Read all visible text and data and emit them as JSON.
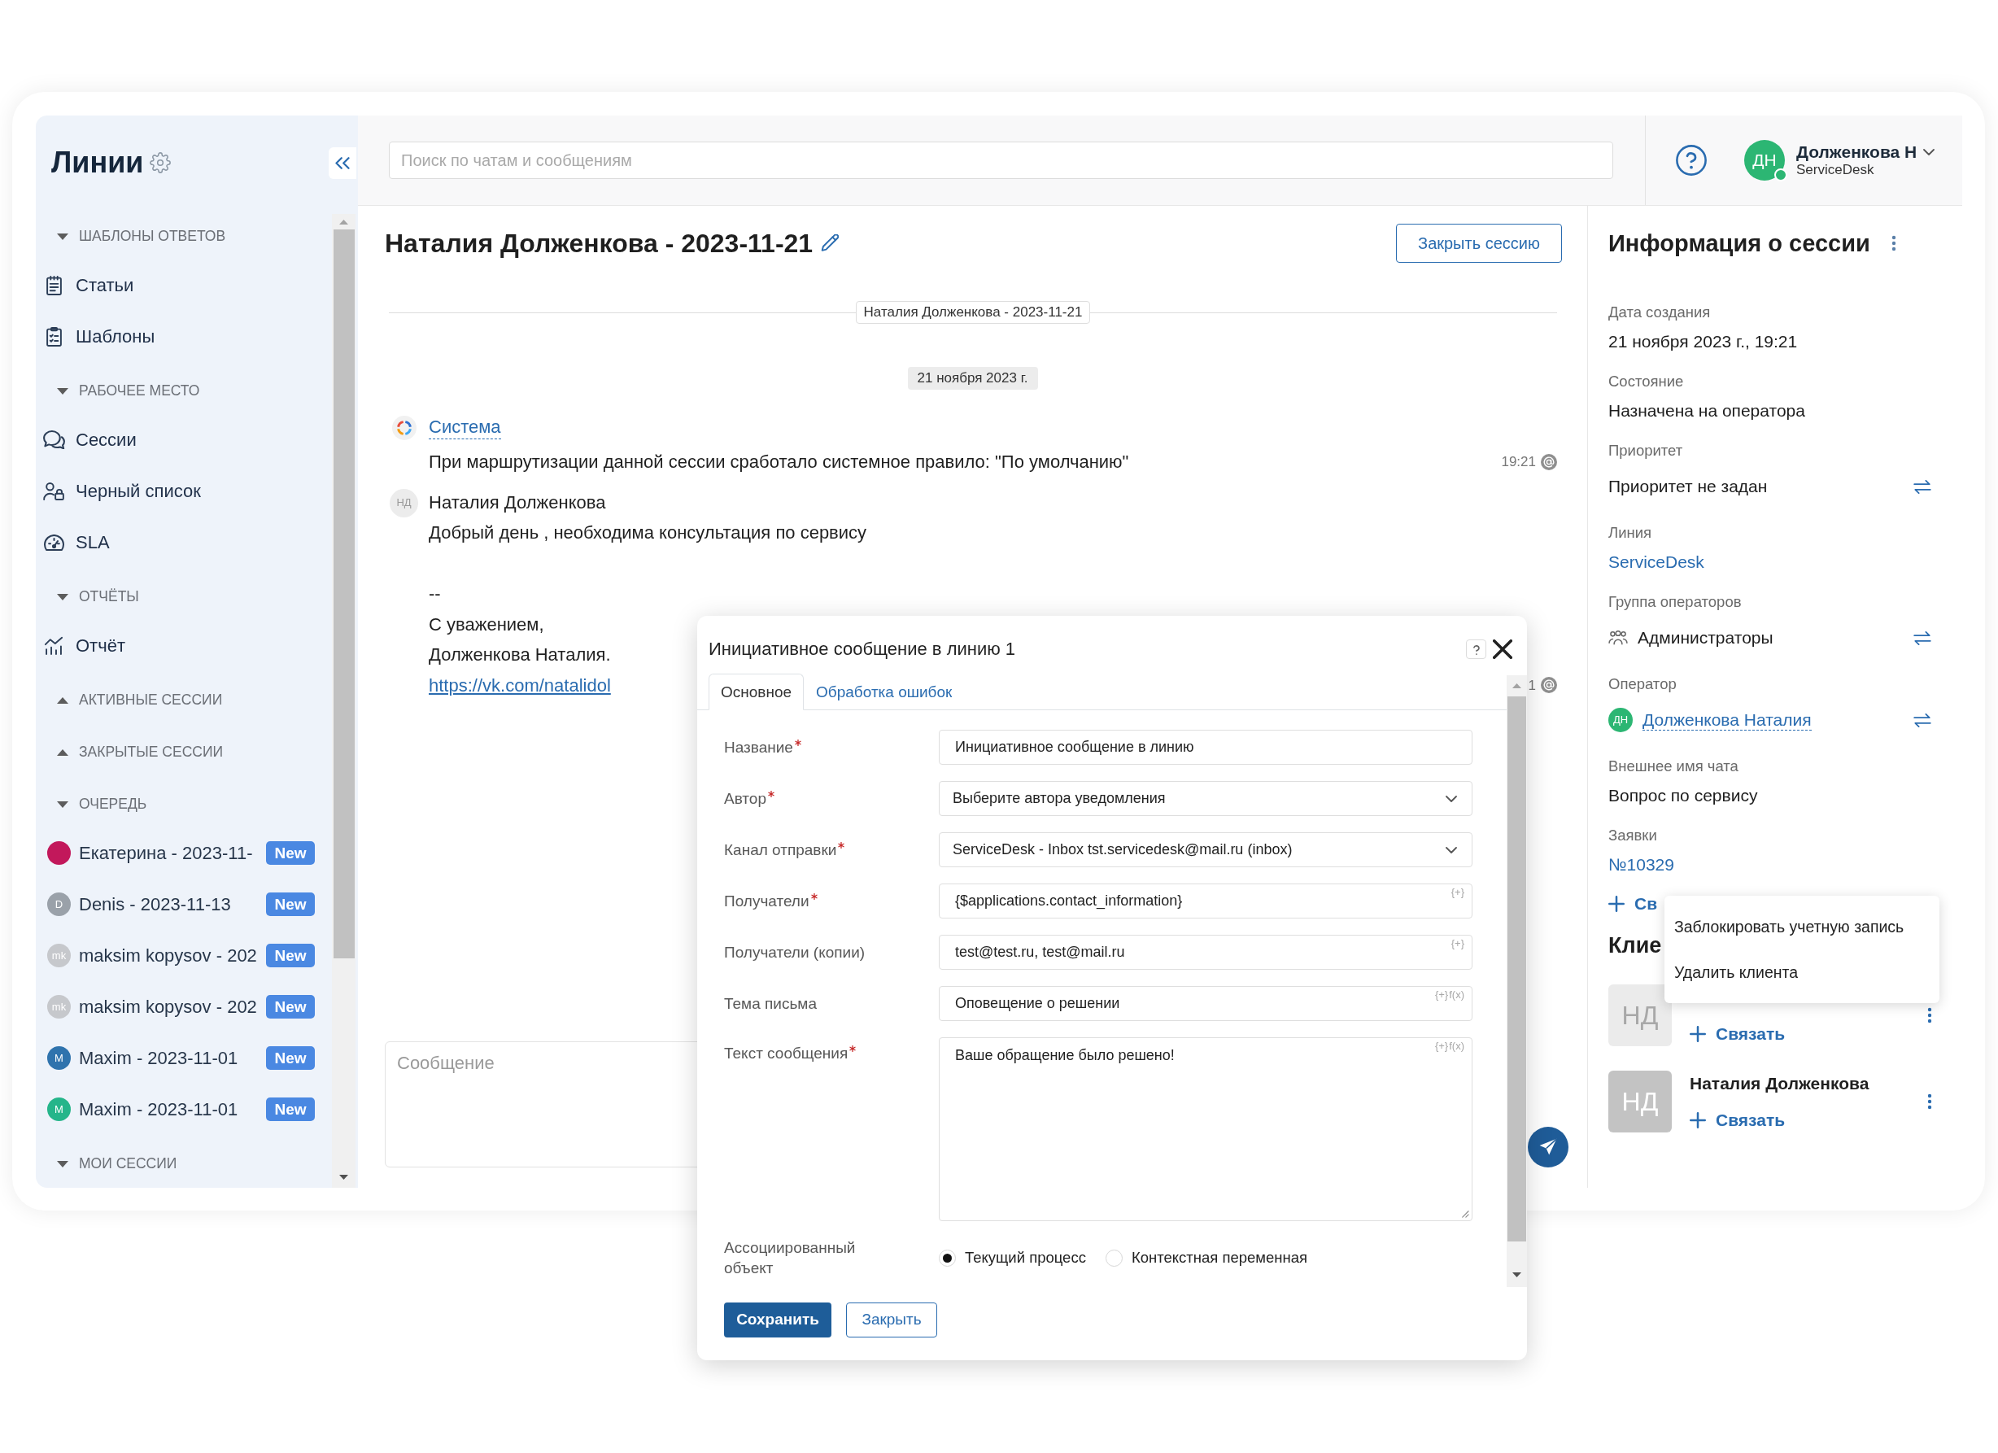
{
  "sidebar": {
    "title": "Линии",
    "sections": [
      {
        "label": "ШАБЛОНЫ ОТВЕТОВ",
        "expanded": true,
        "items": [
          {
            "kind": "page",
            "label": "Статьи"
          },
          {
            "kind": "page",
            "label": "Шаблоны"
          }
        ]
      },
      {
        "label": "РАБОЧЕЕ МЕСТО",
        "expanded": true,
        "items": [
          {
            "kind": "page",
            "label": "Сессии"
          },
          {
            "kind": "page",
            "label": "Черный список"
          },
          {
            "kind": "page",
            "label": "SLA"
          }
        ]
      },
      {
        "label": "ОТЧЁТЫ",
        "expanded": true,
        "items": [
          {
            "kind": "page",
            "label": "Отчёт"
          }
        ]
      },
      {
        "label": "АКТИВНЫЕ СЕССИИ",
        "expanded": false
      },
      {
        "label": "ЗАКРЫТЫЕ СЕССИИ",
        "expanded": false
      },
      {
        "label": "ОЧЕРЕДЬ",
        "expanded": true,
        "items": [
          {
            "kind": "session",
            "label": "Екатерина - 2023-11-",
            "avatar": {
              "kind": "photo",
              "color": "#c2185b"
            },
            "badge": "New"
          },
          {
            "kind": "session",
            "label": "Denis - 2023-11-13",
            "avatar": {
              "kind": "initials",
              "text": "D",
              "color": "#9aa1a9"
            },
            "badge": "New"
          },
          {
            "kind": "session",
            "label": "maksim kopysov - 202",
            "avatar": {
              "kind": "initials",
              "text": "mk",
              "color": "#c6c8cc"
            },
            "badge": "New"
          },
          {
            "kind": "session",
            "label": "maksim kopysov - 202",
            "avatar": {
              "kind": "initials",
              "text": "mk",
              "color": "#c6c8cc"
            },
            "badge": "New"
          },
          {
            "kind": "session",
            "label": "Maxim - 2023-11-01",
            "avatar": {
              "kind": "initials",
              "text": "M",
              "color": "#2f73ad"
            },
            "badge": "New"
          },
          {
            "kind": "session",
            "label": "Maxim - 2023-11-01",
            "avatar": {
              "kind": "initials",
              "text": "M",
              "color": "#25b58a"
            },
            "badge": "New"
          }
        ]
      },
      {
        "label": "МОИ СЕССИИ",
        "expanded": true
      }
    ]
  },
  "header": {
    "search": {
      "placeholder": "Поиск по чатам и сообщениям"
    },
    "user": {
      "initials": "ДН",
      "name": "Долженкова Н",
      "subtitle": "ServiceDesk",
      "online": true
    }
  },
  "chat": {
    "title": "Наталия Долженкова - 2023-11-21",
    "close_button": "Закрыть сессию",
    "session_divider": "Наталия Долженкова - 2023-11-21",
    "date": "21 ноября 2023 г.",
    "messages": [
      {
        "kind": "system",
        "author": "Система",
        "text": "При маршрутизации данной сессии сработало системное правило: \"По умолчанию\"",
        "time": "19:21"
      },
      {
        "kind": "client",
        "avatar": "НД",
        "author": "Наталия Долженкова",
        "text": "Добрый день , необходима консультация по сервису",
        "signature": [
          "--",
          "С уважением,",
          "Долженкова Наталия."
        ],
        "link": "https://vk.com/natalidol",
        "time": "1"
      }
    ],
    "composer": {
      "placeholder": "Сообщение"
    }
  },
  "session_info": {
    "title": "Информация о сессии",
    "fields": [
      {
        "kind": "text",
        "label": "Дата создания",
        "value": "21 ноября 2023 г., 19:21",
        "swap": false
      },
      {
        "kind": "text",
        "label": "Состояние",
        "value": "Назначена на оператора",
        "swap": false
      },
      {
        "kind": "text",
        "label": "Приоритет",
        "value": "Приоритет не задан",
        "swap": true
      },
      {
        "kind": "link",
        "label": "Линия",
        "value": "ServiceDesk",
        "swap": false
      },
      {
        "kind": "group",
        "label": "Группа операторов",
        "value": "Администраторы",
        "swap": true
      },
      {
        "kind": "user",
        "label": "Оператор",
        "avatar": "ДН",
        "value": "Долженкова Наталия",
        "swap": true
      },
      {
        "kind": "text",
        "label": "Внешнее имя чата",
        "value": "Вопрос по сервису",
        "swap": false
      },
      {
        "kind": "link",
        "label": "Заявки",
        "value": "№10329",
        "swap": false
      }
    ],
    "add_link": "Св",
    "clients_title": "Клие",
    "clients": [
      {
        "initials": "НД",
        "dimmed": true,
        "link": "Связать"
      },
      {
        "initials": "НД",
        "dimmed": false,
        "name": "Наталия Долженкова",
        "link": "Связать"
      }
    ]
  },
  "context_menu": {
    "items": [
      "Заблокировать учетную запись",
      "Удалить клиента"
    ]
  },
  "dialog": {
    "title": "Инициативное сообщение в линию 1",
    "tabs": [
      {
        "label": "Основное",
        "selected": true
      },
      {
        "label": "Обработка ошибок",
        "selected": false
      }
    ],
    "fields": [
      {
        "kind": "input",
        "label": "Название",
        "required": true,
        "value": "Инициативное сообщение в линию"
      },
      {
        "kind": "select",
        "label": "Автор",
        "required": true,
        "value": "Выберите автора уведомления"
      },
      {
        "kind": "select",
        "label": "Канал отправки",
        "required": true,
        "value": "ServiceDesk - Inbox tst.servicedesk@mail.ru (inbox)"
      },
      {
        "kind": "input",
        "label": "Получатели",
        "required": true,
        "value": "{$applications.contact_information}",
        "actions": [
          "{+}"
        ]
      },
      {
        "kind": "input",
        "label": "Получатели (копии)",
        "required": false,
        "value": "test@test.ru, test@mail.ru",
        "actions": [
          "{+}"
        ]
      },
      {
        "kind": "input",
        "label": "Тема письма",
        "required": false,
        "value": "Оповещение о решении",
        "actions": [
          "{+}",
          "f(x)"
        ]
      },
      {
        "kind": "textarea",
        "label": "Текст сообщения",
        "required": true,
        "value": "Ваше обращение было решено!",
        "actions": [
          "{+}",
          "f(x)"
        ]
      },
      {
        "kind": "radio",
        "label": "Ассоциированный объект",
        "required": false,
        "options": [
          {
            "label": "Текущий процесс",
            "selected": true
          },
          {
            "label": "Контекстная переменная",
            "selected": false
          }
        ]
      }
    ],
    "buttons": [
      {
        "kind": "primary",
        "label": "Сохранить"
      },
      {
        "kind": "secondary",
        "label": "Закрыть"
      }
    ]
  }
}
